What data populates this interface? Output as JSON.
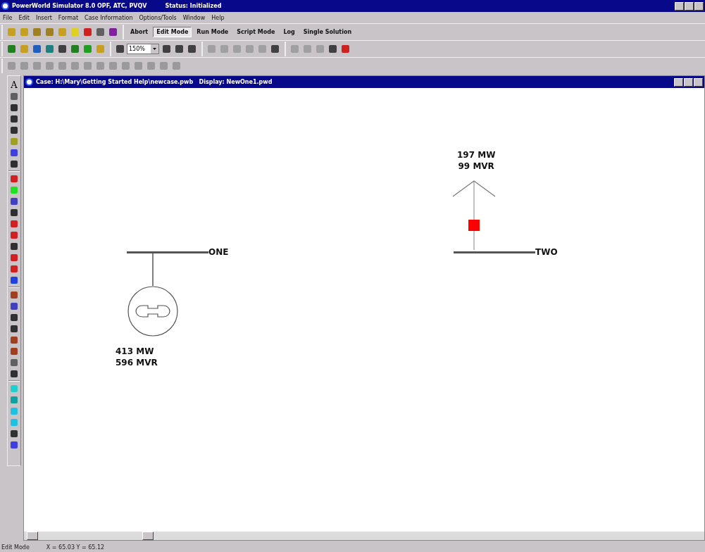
{
  "window": {
    "title": "PowerWorld Simulator 8.0 OPF, ATC, PVQV",
    "status": "Status: Initialized"
  },
  "menu": [
    "File",
    "Edit",
    "Insert",
    "Format",
    "Case Information",
    "Options/Tools",
    "Window",
    "Help"
  ],
  "mode_buttons": [
    {
      "label": "Abort",
      "selected": false
    },
    {
      "label": "Edit Mode",
      "selected": true
    },
    {
      "label": "Run Mode",
      "selected": false
    },
    {
      "label": "Script Mode",
      "selected": false
    },
    {
      "label": "Log",
      "selected": false
    },
    {
      "label": "Single Solution",
      "selected": false
    }
  ],
  "zoom": {
    "value": "150%"
  },
  "left_toolbar": {
    "text_tool": "A"
  },
  "document": {
    "title": "Case: H:\\Mary\\Getting Started Help\\newcase.pwb   Display: NewOne1.pwd"
  },
  "diagram": {
    "buses": [
      {
        "name": "ONE",
        "kind": "generator",
        "mw": "413 MW",
        "mvar": "596 MVR"
      },
      {
        "name": "TWO",
        "kind": "load",
        "mw": "197 MW",
        "mvar": "99 MVR",
        "breaker_closed": true
      }
    ]
  },
  "status_bar": {
    "mode": "Edit Mode",
    "coordinates": "X = 65.03 Y = 65.12"
  }
}
